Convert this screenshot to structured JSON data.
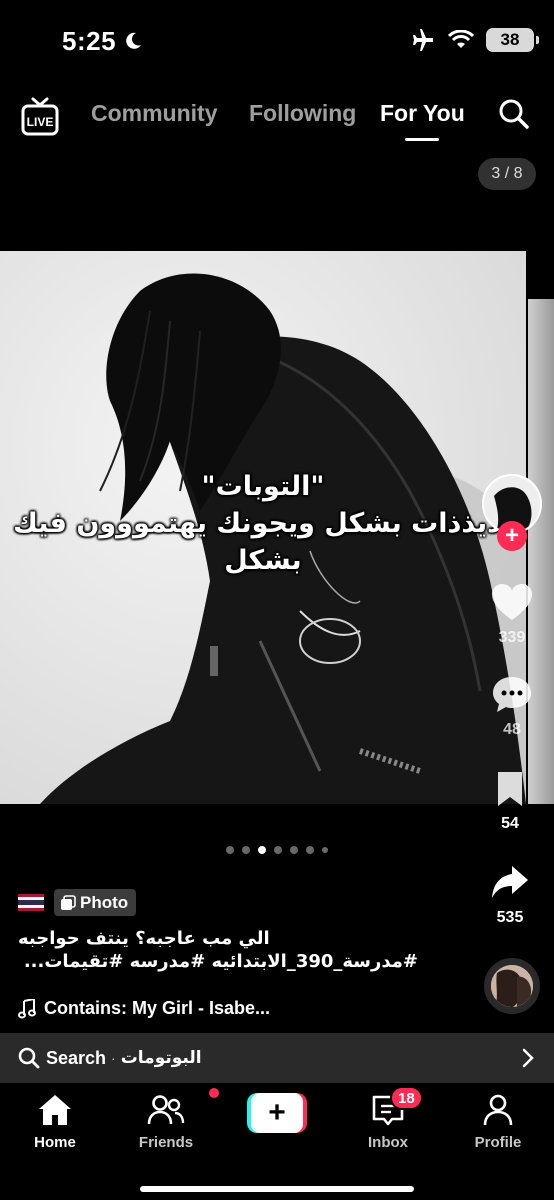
{
  "status_bar": {
    "time": "5:25",
    "battery": "38"
  },
  "top_nav": {
    "tabs": [
      {
        "label": "Community",
        "active": false
      },
      {
        "label": "Following",
        "active": false
      },
      {
        "label": "For You",
        "active": true
      }
    ]
  },
  "post": {
    "page_counter": "3 / 8",
    "overlay_text": [
      "\"التوبات\"",
      "لذيذذات بشكل ويجونك يهتمووون فيك",
      "بشكل"
    ],
    "badge": "Photo",
    "caption_line1": "الي مب عاجبه؟ ينتف حواجبه",
    "caption_line2": "#مدرسة_390_الابتدائيه #مدرسه #تقيمات...",
    "music": "Contains: My Girl - Isabe...",
    "dots_total": 7,
    "dots_active_index": 2
  },
  "actions": {
    "likes": "339",
    "comments": "48",
    "saves": "54",
    "shares": "535"
  },
  "search_bar": {
    "label": "Search",
    "separator": "·",
    "query": "البوتومات"
  },
  "bottom_nav": {
    "items": [
      {
        "label": "Home",
        "active": true
      },
      {
        "label": "Friends",
        "active": false
      },
      {
        "label": "Inbox",
        "active": false
      },
      {
        "label": "Profile",
        "active": false
      }
    ],
    "inbox_badge": "18"
  },
  "colors": {
    "accent": "#fe2c55",
    "cyan": "#25f4ee",
    "background": "#000000"
  }
}
